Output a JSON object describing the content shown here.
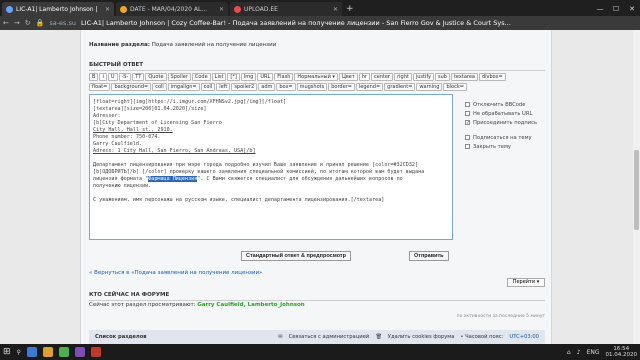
{
  "browser": {
    "tabs": [
      {
        "label": "LIC-A1| Lamberto Johnson |",
        "active": true
      },
      {
        "label": "DATE - MAR/04/2020 AL..."
      },
      {
        "label": "UPLOAD.EE"
      }
    ],
    "new_tab": "+",
    "window": {
      "min": "—",
      "max": "☐",
      "close": "✕"
    },
    "address": {
      "url": "sa-es.su",
      "title": "LIC-A1| Lamberto Johnson | Cozy Coffee-Bar! - Подача заявлений на получение лицензии - San Fierro Gov & Justice & Court Sys..."
    }
  },
  "section": {
    "label": "Название раздела:",
    "value": "Подача заявлений на получение лицензии"
  },
  "reply": {
    "title": "БЫСТРЫЙ ОТВЕТ",
    "toolbar1": [
      "B",
      "i",
      "U",
      "-S-",
      "TT",
      "Quote",
      "Spoiler",
      "Code",
      "List",
      "[*]",
      "Img",
      "URL",
      "Flash",
      "Нормальный ▾",
      "Цвет",
      "hr",
      "center",
      "right",
      "justify",
      "sub",
      "textarea",
      "divbox="
    ],
    "toolbar2": [
      "float=",
      "background=",
      "coll",
      "imgalign=",
      "coll",
      "left",
      "spoiler2",
      "adm",
      "box=",
      "mugshots",
      "border=",
      "legend=",
      "gradient=",
      "warning",
      "block="
    ],
    "editor_lines": [
      "[float=right][img]https://i.imgur.com/XFHNSv2.jpg[/img][/float]",
      "[textarea][size=200]01.04.2020[/size]",
      "Adresser:",
      "[b]City Department of Licensing San Fierro",
      "City Hall, Hall st., 2910.",
      "Phone number: 750-074.",
      "Garry Caulfield.",
      "Adress: 1 City Hall, San Fierro, San Andreas, USA[/b]",
      "",
      "Департамент лицензирования при мэре города подробно изучил Ваше заявление и принял решение [color=#32CD32]",
      "[b]ОДОБРИТЬ[/b] [/color] проверку вашего заявления специальной комиссией, по итогам которой вам будет выдана",
      "лицензия формата \"Фармаца Лицензия\". С Вами свяжется специалист для обсуждения дальнейших вопросов по",
      "получению лицензии.",
      "",
      "С уважением, имя персонажа на русском языке, специалист департамента лицензирования.[/textarea]"
    ],
    "options": [
      {
        "label": "Отключить BBCode",
        "checked": false
      },
      {
        "label": "Не обрабатывать URL",
        "checked": false
      },
      {
        "label": "Присоединить подпись",
        "checked": true
      },
      {
        "label": "Подписаться на тему",
        "checked": false
      },
      {
        "label": "Закрыть тему",
        "checked": false
      }
    ],
    "btn_advanced": "Стандартный ответ & предпросмотр",
    "btn_send": "Отправить"
  },
  "back_link": "« Вернуться в «Подача заявлений на получение лицензии»",
  "next_btn": "Перейти",
  "online": {
    "title": "КТО СЕЙЧАС НА ФОРУМЕ",
    "text": "Сейчас этот раздел просматривают:",
    "users": "Garry Caulfield, Lamberto_Johnson",
    "note": "по активности за последние 5 минут"
  },
  "footer": {
    "left": "Список разделов",
    "contact": "Связаться с администрацией",
    "cookies": "Удалить cookies форума",
    "tz": "• Часовой пояс:",
    "tz_val": "UTC+03:00"
  },
  "taskbar": {
    "lang": "ENG",
    "time": "16:54",
    "date": "01.04.2020"
  },
  "colors": {
    "accent": "#2f67b3",
    "link": "#1a5aa8",
    "green_user": "#2a9d2a"
  }
}
